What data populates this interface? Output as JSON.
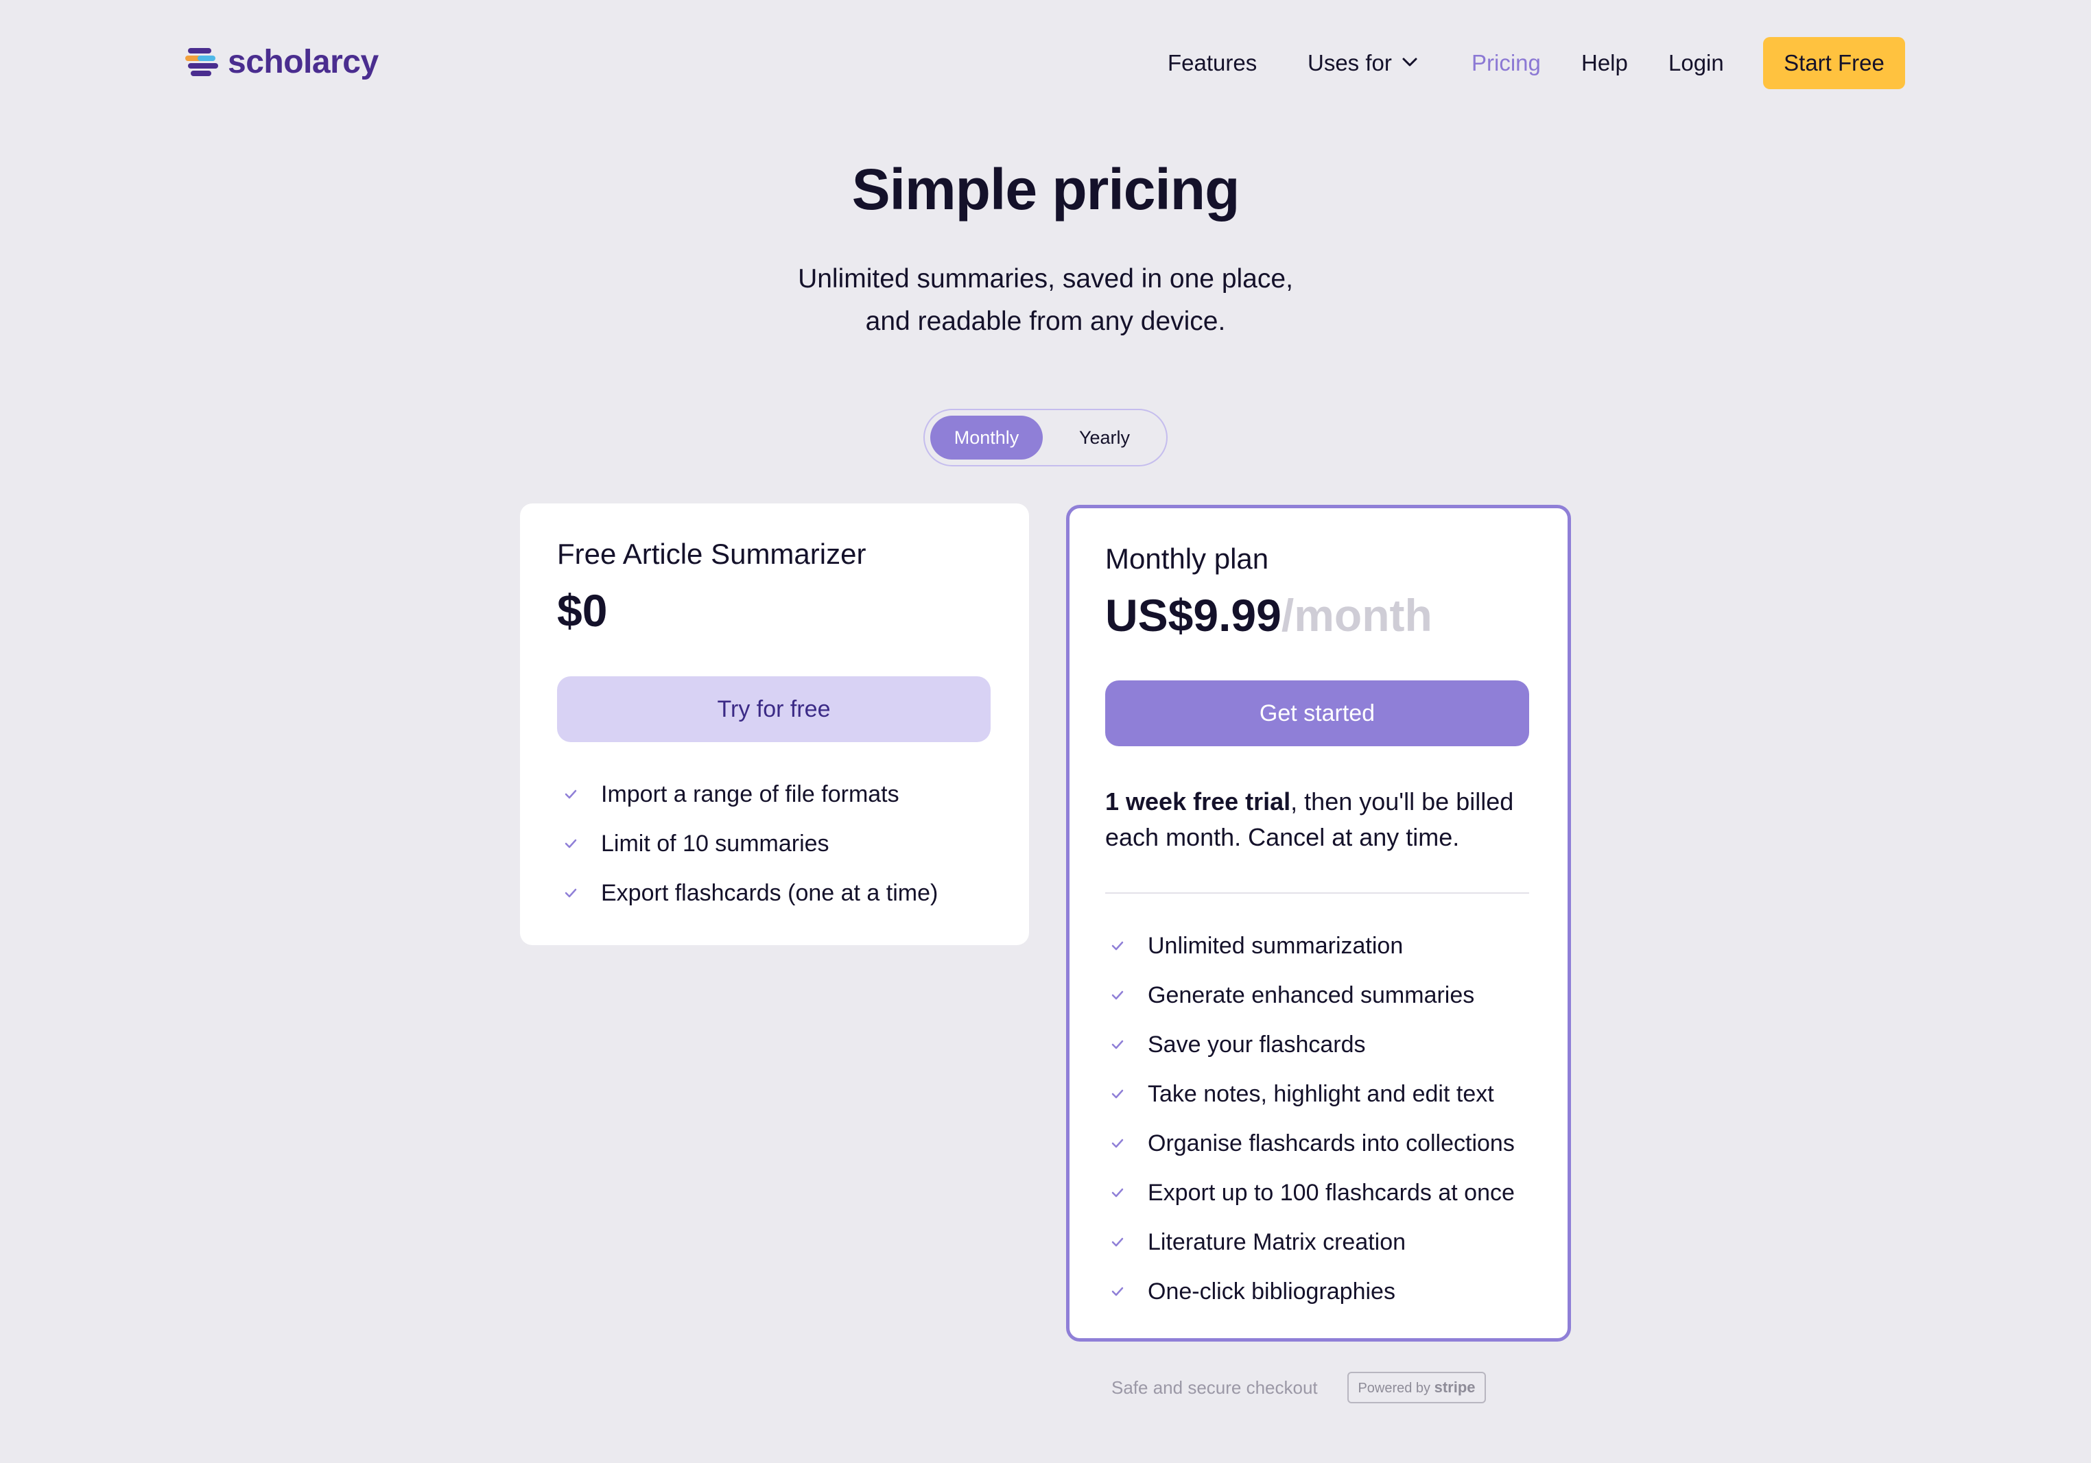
{
  "header": {
    "logo_text": "scholarcy",
    "nav": {
      "features": "Features",
      "uses_for": "Uses for",
      "pricing": "Pricing",
      "help": "Help",
      "login": "Login"
    },
    "cta": "Start Free"
  },
  "hero": {
    "title": "Simple pricing",
    "subtitle_line1": "Unlimited summaries, saved in one place,",
    "subtitle_line2": "and readable from any device."
  },
  "billing_toggle": {
    "options": [
      "Monthly",
      "Yearly"
    ],
    "selected": "Monthly"
  },
  "plans": {
    "free": {
      "name": "Free Article Summarizer",
      "price": "$0",
      "button": "Try for free",
      "features": [
        "Import a range of file formats",
        "Limit of 10 summaries",
        "Export flashcards (one at a time)"
      ]
    },
    "monthly": {
      "name": "Monthly plan",
      "price": "US$9.99",
      "period": "/month",
      "button": "Get started",
      "trial_bold": "1 week free trial",
      "trial_rest": ", then you'll be billed each month. Cancel at any time.",
      "features": [
        "Unlimited summarization",
        "Generate enhanced summaries",
        "Save your flashcards",
        "Take notes, highlight and edit text",
        "Organise flashcards into collections",
        "Export up to 100 flashcards at once",
        "Literature Matrix creation",
        "One-click bibliographies"
      ]
    }
  },
  "footer": {
    "secure_text": "Safe and secure checkout",
    "badge_prefix": "Powered by",
    "badge_brand": "stripe"
  },
  "colors": {
    "background": "#ebeaef",
    "accent_purple": "#8f7fd7",
    "brand_purple": "#4a2d8f",
    "cta_yellow": "#ffc23f",
    "free_button": "#d8d2f4"
  },
  "icons": {
    "logo": "scholarcy-logo-icon",
    "dropdown": "chevron-down-icon",
    "feature_bullet": "check-icon"
  }
}
